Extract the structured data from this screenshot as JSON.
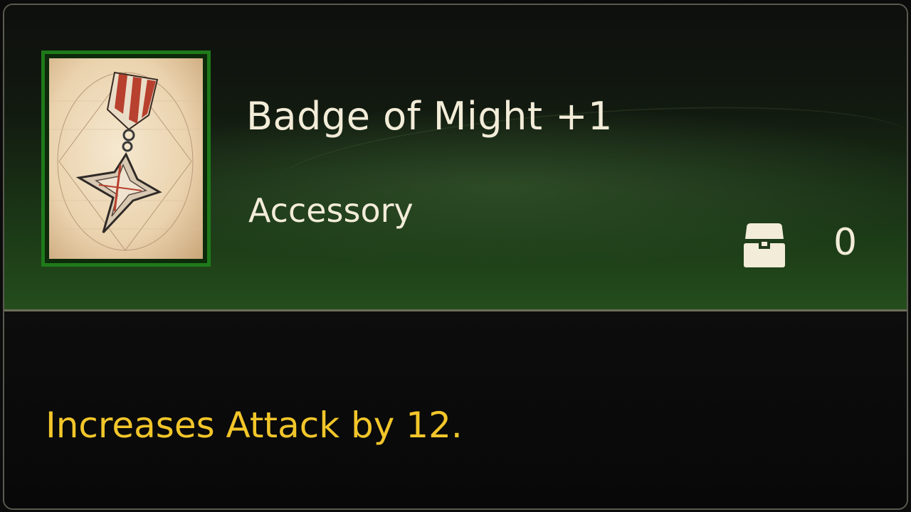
{
  "item": {
    "name": "Badge of Might +1",
    "category": "Accessory",
    "icon": "badge-medal-icon",
    "owned_count": "0",
    "description": "Increases Attack by 12."
  },
  "icons": {
    "inventory": "treasure-chest-icon"
  },
  "colors": {
    "name_text": "#f2ecd8",
    "description_text": "#f2c62a",
    "icon_border": "#1f7a1a"
  }
}
